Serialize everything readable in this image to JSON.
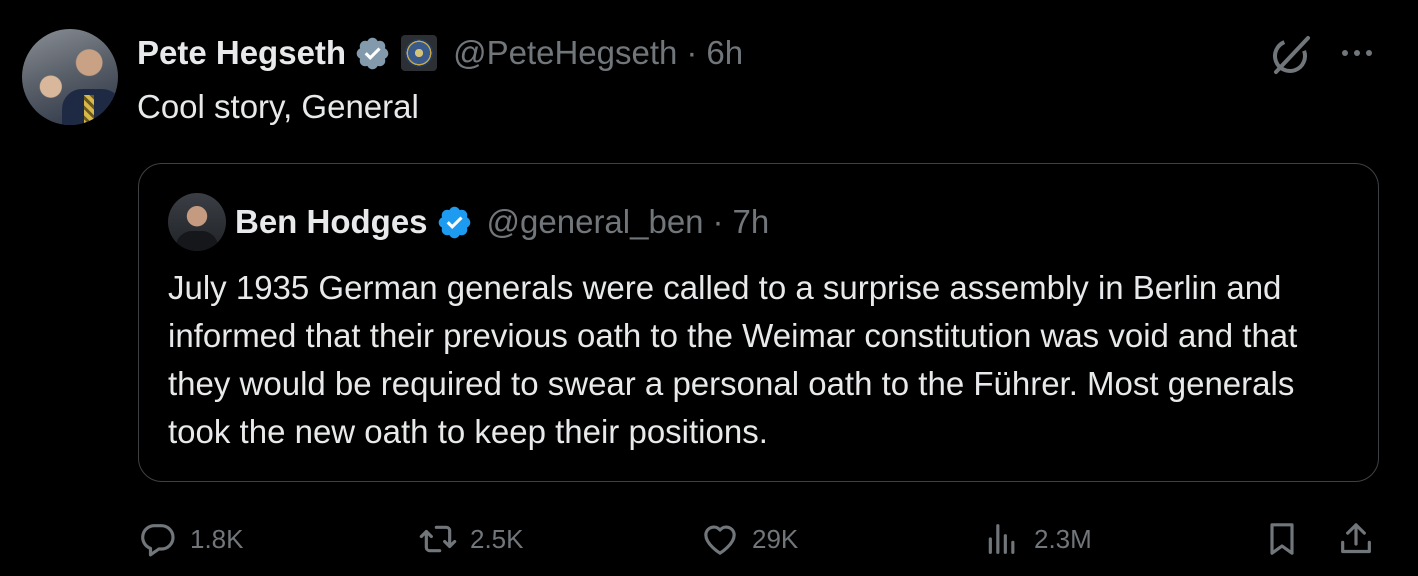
{
  "author": {
    "name": "Pete Hegseth",
    "handle": "@PeteHegseth",
    "separator": "·",
    "time": "6h",
    "verified_color": "#829aab"
  },
  "tweet_text": "Cool story, General",
  "quote": {
    "name": "Ben Hodges",
    "handle": "@general_ben",
    "separator": "·",
    "time": "7h",
    "verified_color": "#1d9bf0",
    "text": "July 1935 German generals were called to a surprise assembly in Berlin and informed that their previous oath to the Weimar constitution was void and that they would be required to swear a personal oath to the Führer. Most generals took the new oath to keep their positions."
  },
  "actions": {
    "replies": "1.8K",
    "reposts": "2.5K",
    "likes": "29K",
    "views": "2.3M"
  },
  "colors": {
    "background": "#000000",
    "text": "#e7e9ea",
    "muted": "#71767b",
    "border": "#3e4144"
  }
}
